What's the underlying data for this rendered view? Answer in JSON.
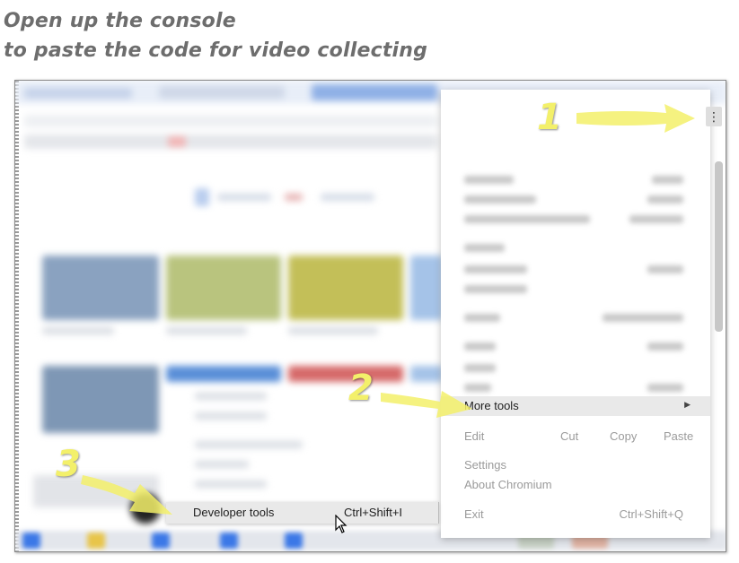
{
  "caption": {
    "line1": "Open up the console",
    "line2": "to paste the code for video collecting"
  },
  "steps": {
    "step1": "1",
    "step2": "2",
    "step3": "3"
  },
  "chrome": {
    "menu_button_icon": "vertical-dots-icon",
    "menu": {
      "more_tools": "More tools",
      "edit": {
        "label": "Edit",
        "cut": "Cut",
        "copy": "Copy",
        "paste": "Paste"
      },
      "settings": "Settings",
      "about": "About Chromium",
      "exit": {
        "label": "Exit",
        "shortcut": "Ctrl+Shift+Q"
      }
    },
    "submenu": {
      "developer_tools": "Developer tools",
      "shortcut": "Ctrl+Shift+I"
    }
  },
  "colors": {
    "annotation_yellow": "#f3f06a",
    "highlight": "#e9e9e9",
    "caption_gray": "#6d6d6d",
    "accent_blue": "#3b78e7"
  }
}
